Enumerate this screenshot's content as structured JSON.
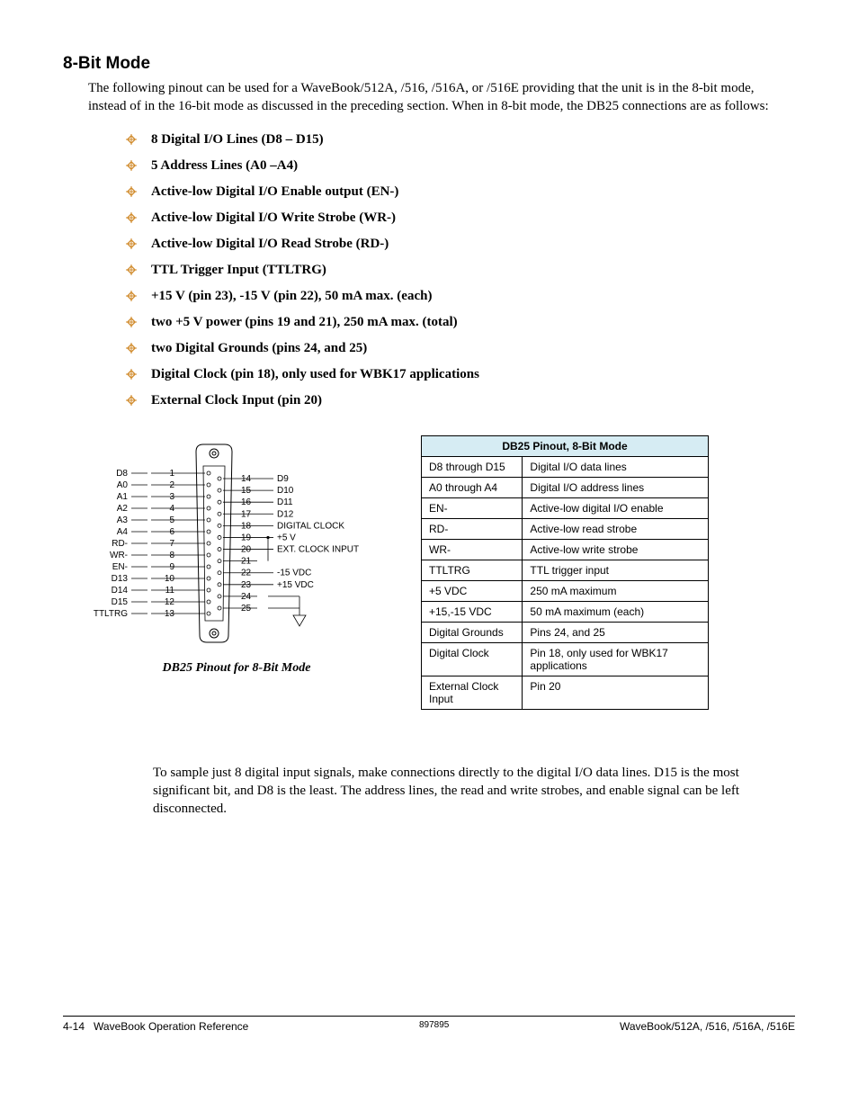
{
  "heading": "8-Bit Mode",
  "intro": "The following pinout can be used for a WaveBook/512A, /516, /516A, or /516E providing that the unit is in the 8-bit mode, instead of in the 16-bit mode as discussed in the preceding section.  When in 8-bit mode, the DB25 connections are as follows:",
  "features": [
    "8 Digital I/O Lines (D8 – D15)",
    "5 Address Lines (A0 –A4)",
    "Active-low Digital I/O Enable output  (EN-)",
    "Active-low Digital I/O Write Strobe (WR-)",
    "Active-low Digital I/O Read Strobe (RD-)",
    "TTL Trigger Input (TTLTRG)",
    "+15 V (pin 23), -15 V (pin 22), 50 mA max. (each)",
    "two +5 V power (pins 19 and 21), 250 mA max.  (total)",
    "two Digital Grounds (pins 24, and 25)",
    "Digital Clock (pin 18), only used for WBK17 applications",
    "External Clock Input (pin 20)"
  ],
  "diagram": {
    "left_pins": [
      {
        "label": "D8",
        "num": "1"
      },
      {
        "label": "A0",
        "num": "2"
      },
      {
        "label": "A1",
        "num": "3"
      },
      {
        "label": "A2",
        "num": "4"
      },
      {
        "label": "A3",
        "num": "5"
      },
      {
        "label": "A4",
        "num": "6"
      },
      {
        "label": "RD-",
        "num": "7"
      },
      {
        "label": "WR-",
        "num": "8"
      },
      {
        "label": "EN-",
        "num": "9"
      },
      {
        "label": "D13",
        "num": "10"
      },
      {
        "label": "D14",
        "num": "11"
      },
      {
        "label": "D15",
        "num": "12"
      },
      {
        "label": "TTLTRG",
        "num": "13"
      }
    ],
    "right_pins": [
      {
        "num": "14",
        "label": "D9"
      },
      {
        "num": "15",
        "label": "D10"
      },
      {
        "num": "16",
        "label": "D11"
      },
      {
        "num": "17",
        "label": "D12"
      },
      {
        "num": "18",
        "label": "DIGITAL CLOCK"
      },
      {
        "num": "19",
        "label": "+5 V"
      },
      {
        "num": "20",
        "label": "EXT. CLOCK INPUT"
      },
      {
        "num": "21",
        "label": ""
      },
      {
        "num": "22",
        "label": "-15 VDC"
      },
      {
        "num": "23",
        "label": "+15 VDC"
      },
      {
        "num": "24",
        "label": ""
      },
      {
        "num": "25",
        "label": ""
      }
    ],
    "caption": "DB25 Pinout for 8-Bit Mode"
  },
  "table_title": "DB25 Pinout, 8-Bit Mode",
  "table_rows": [
    {
      "a": "D8 through D15",
      "b": "Digital I/O data lines"
    },
    {
      "a": "A0 through A4",
      "b": "Digital I/O address lines"
    },
    {
      "a": "EN-",
      "b": "Active-low digital I/O enable"
    },
    {
      "a": "RD-",
      "b": "Active-low read strobe"
    },
    {
      "a": "WR-",
      "b": "Active-low write strobe"
    },
    {
      "a": "TTLTRG",
      "b": "TTL trigger input"
    },
    {
      "a": "+5 VDC",
      "b": "250 mA maximum"
    },
    {
      "a": "+15,-15 VDC",
      "b": "50 mA maximum (each)"
    },
    {
      "a": "Digital Grounds",
      "b": "Pins 24, and 25"
    },
    {
      "a": "Digital Clock",
      "b": "Pin 18, only used for WBK17 applications"
    },
    {
      "a": "External Clock Input",
      "b": "Pin 20"
    }
  ],
  "closing": "To sample just 8 digital input signals, make connections directly to the digital I/O data lines.  D15 is the most significant bit, and D8 is the least.  The address lines, the read and write strobes, and enable signal can be left disconnected.",
  "footer": {
    "left_page": "4-14",
    "left_title": "WaveBook Operation Reference",
    "center": "897895",
    "right": "WaveBook/512A, /516, /516A, /516E"
  }
}
